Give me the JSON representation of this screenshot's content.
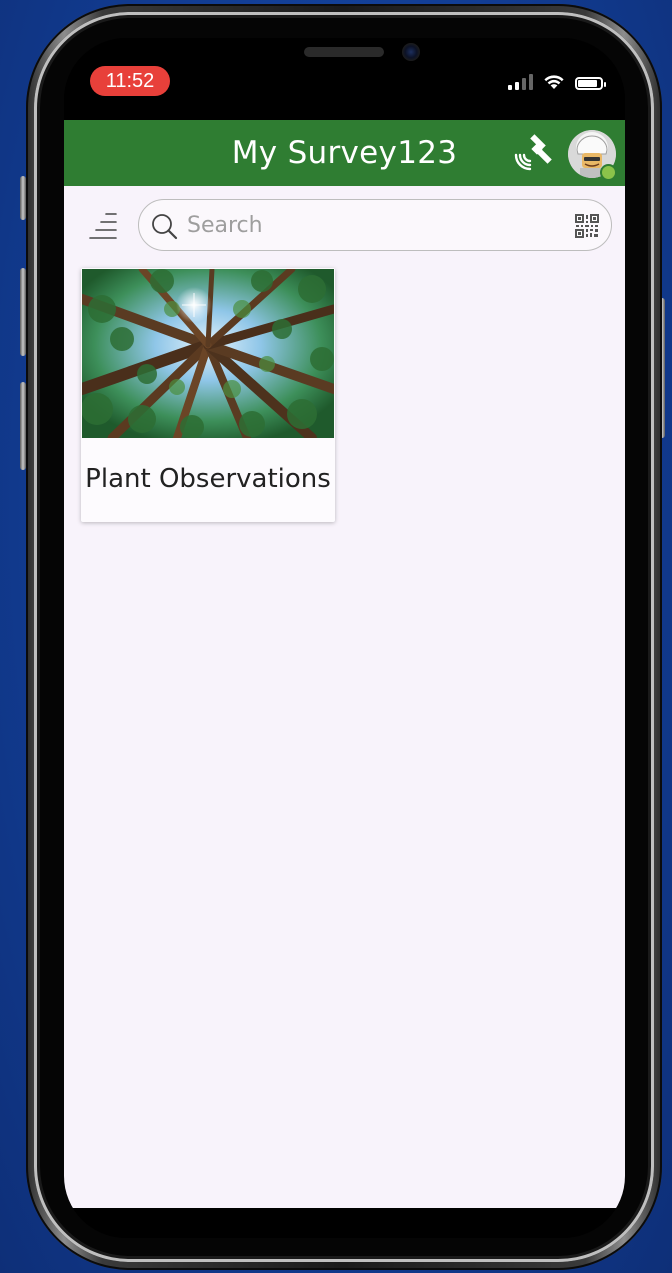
{
  "status_bar": {
    "time": "11:52",
    "signal_bars": 4,
    "signal_filled": 2
  },
  "header": {
    "title": "My Survey123",
    "bg_color": "#2f7d32"
  },
  "toolbar": {
    "search": {
      "placeholder": "Search",
      "value": ""
    }
  },
  "surveys": [
    {
      "title": "Plant Observations",
      "thumbnail": "forest-canopy"
    }
  ],
  "colors": {
    "time_pill": "#e8403a",
    "content_bg": "#f8f3fb",
    "online_dot": "#8bc34a"
  }
}
